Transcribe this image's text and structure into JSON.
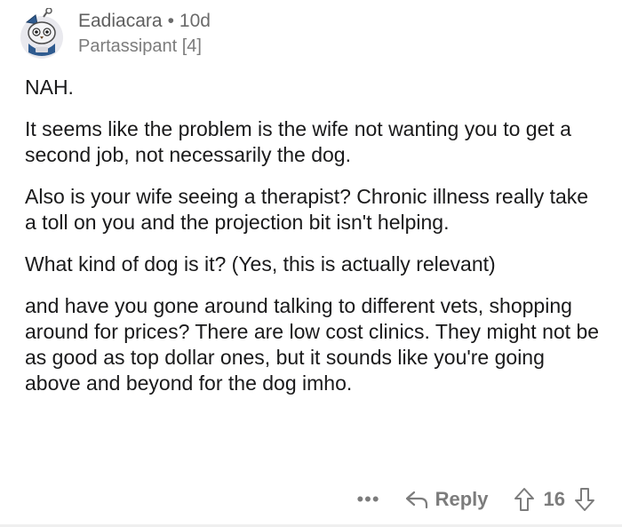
{
  "comment": {
    "username": "Eadiacara",
    "separator": "•",
    "age": "10d",
    "flair": "Partassipant [4]",
    "paragraphs": [
      "NAH.",
      "It seems like the problem is the wife not wanting you to get a second job, not necessarily the dog.",
      "Also is your wife seeing a therapist? Chronic illness really take a toll on you and the projection bit isn't helping.",
      "What kind of dog is it? (Yes, this is actually relevant)",
      "and have you gone around talking to different vets, shopping around for prices? There are low cost clinics. They might not be as good as top dollar ones, but it sounds like you're going above and beyond for the dog imho."
    ]
  },
  "actions": {
    "more_label": "•••",
    "reply_label": "Reply",
    "vote_count": "16"
  },
  "icons": {
    "avatar": "snoo-avatar-icon",
    "more": "more-options-icon",
    "reply": "reply-arrow-icon",
    "upvote": "upvote-arrow-icon",
    "downvote": "downvote-arrow-icon"
  },
  "colors": {
    "text": "#1a1a1b",
    "meta": "#7c7c7c",
    "avatar_bg": "#e9e9ee",
    "avatar_accent": "#2f5b8f"
  }
}
